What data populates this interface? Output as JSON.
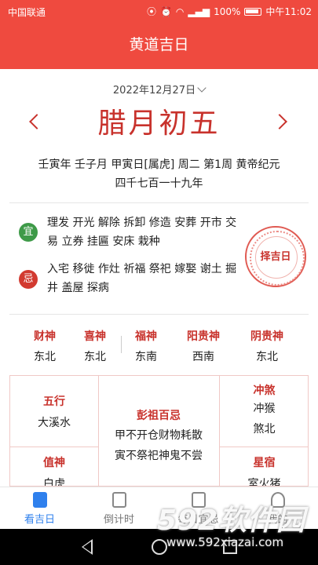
{
  "status_bar": {
    "carrier": "中国联通",
    "battery": "100%",
    "time": "中午11:02"
  },
  "header": {
    "title": "黄道吉日"
  },
  "date": {
    "gregorian": "2022年12月27日",
    "lunar": "腊月初五"
  },
  "ganzhi": "壬寅年 壬子月 甲寅日[属虎] 周二 第1周 黄帝纪元四千七百一十九年",
  "yi": {
    "badge": "宜",
    "activities": "理发 开光 解除 拆卸 修造 安葬 开市 交易 立券 挂匾 安床 栽种"
  },
  "ji": {
    "badge": "忌",
    "activities": "入宅 移徙 作灶 祈福 祭祀 嫁娶 谢土 掘井 盖屋 探病"
  },
  "seal": {
    "label": "择吉日"
  },
  "gods": [
    {
      "title": "财神",
      "value": "东北"
    },
    {
      "title": "喜神",
      "value": "东北"
    },
    {
      "title": "福神",
      "value": "东南"
    },
    {
      "title": "阳贵神",
      "value": "西南"
    },
    {
      "title": "阴贵神",
      "value": "东北"
    }
  ],
  "grid": {
    "wuxing": {
      "title": "五行",
      "value": "大溪水"
    },
    "pengzu": {
      "title": "彭祖百忌",
      "line1": "甲不开仓财物耗散",
      "line2": "寅不祭祀神鬼不尝"
    },
    "chongsha": {
      "title": "冲煞",
      "line1": "冲猴",
      "line2": "煞北"
    },
    "zhishen": {
      "title": "值神",
      "value": "白虎"
    },
    "xingxiu": {
      "title": "星宿",
      "value": "室火猪"
    }
  },
  "tabs": [
    {
      "label": "看吉日",
      "active": true
    },
    {
      "label": "倒计时",
      "active": false
    },
    {
      "label": "每日宜忌",
      "active": false
    },
    {
      "label": "我的",
      "active": false
    }
  ],
  "watermark": {
    "brand": "592软件园",
    "url": "www.592xiazai.com"
  },
  "colors": {
    "header": "#ef4a3f",
    "accent_red": "#c8322c",
    "yi_green": "#3e9a48",
    "tab_active": "#2f80ed"
  }
}
